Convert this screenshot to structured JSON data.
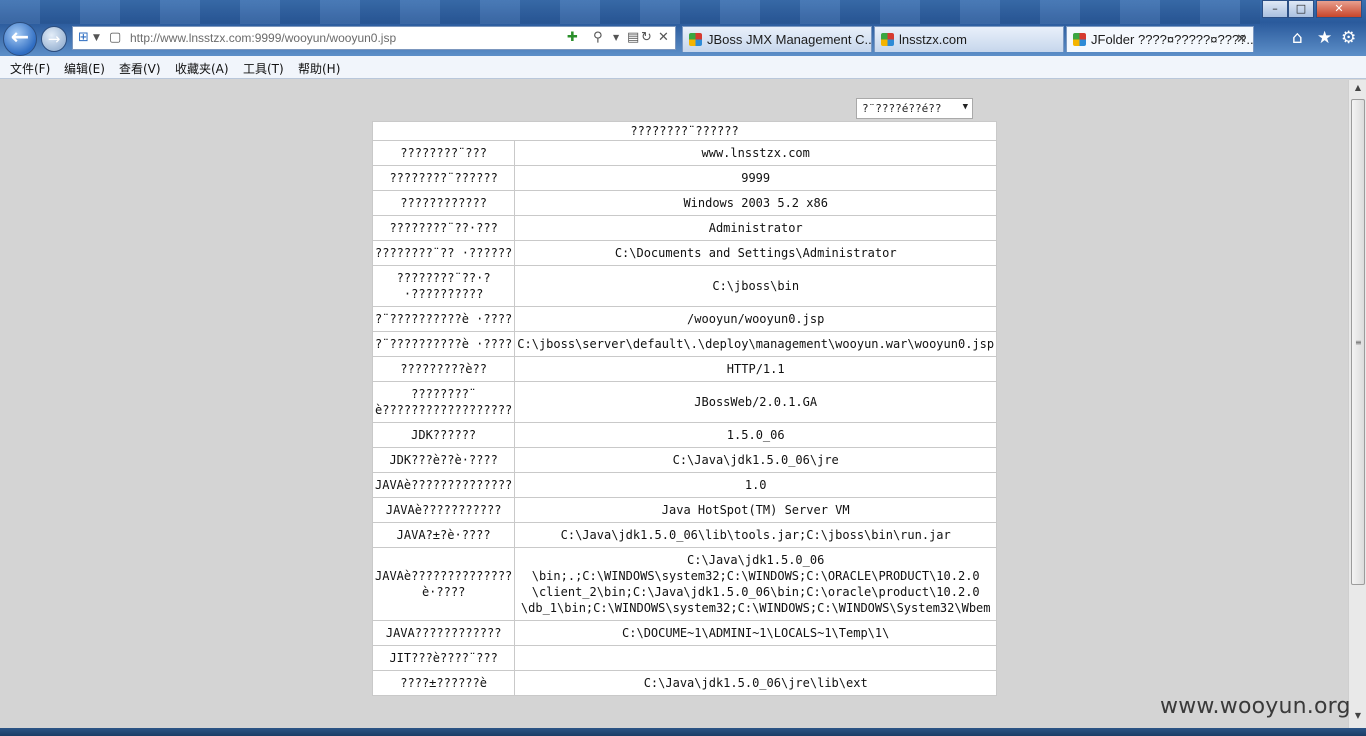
{
  "browser": {
    "url": "http://www.lnsstzx.com:9999/wooyun/wooyun0.jsp",
    "tabs": [
      {
        "label": "JBoss JMX Management C..."
      },
      {
        "label": "lnsstzx.com"
      },
      {
        "label": "JFolder ????¤?????¤????..."
      }
    ],
    "window_controls": {
      "minimize": "–",
      "maximize": "□",
      "close": "✕"
    }
  },
  "menubar": [
    "文件(F)",
    "编辑(E)",
    "查看(V)",
    "收藏夹(A)",
    "工具(T)",
    "帮助(H)"
  ],
  "page": {
    "language_select": "?¨????é??é??",
    "table_title": "????????¨??????",
    "rows": [
      {
        "label": "????????¨???",
        "value": "www.lnsstzx.com"
      },
      {
        "label": "????????¨??????",
        "value": "9999"
      },
      {
        "label": "????????????",
        "value": "Windows 2003 5.2 x86"
      },
      {
        "label": "????????¨??·???",
        "value": "Administrator"
      },
      {
        "label": "????????¨?? ·??????",
        "value": "C:\\Documents and Settings\\Administrator"
      },
      {
        "label": "????????¨??·? ·??????????",
        "value": "C:\\jboss\\bin"
      },
      {
        "label": "?¨??????????è ·????",
        "value": "/wooyun/wooyun0.jsp"
      },
      {
        "label": "?¨??????????è ·????",
        "value": "C:\\jboss\\server\\default\\.\\deploy\\management\\wooyun.war\\wooyun0.jsp"
      },
      {
        "label": "?????????è??",
        "value": "HTTP/1.1"
      },
      {
        "label": "????????¨ è??????????????????",
        "value": "JBossWeb/2.0.1.GA"
      },
      {
        "label": "JDK??????",
        "value": "1.5.0_06"
      },
      {
        "label": "JDK???è??è·????",
        "value": "C:\\Java\\jdk1.5.0_06\\jre"
      },
      {
        "label": "JAVAè??????????????",
        "value": "1.0"
      },
      {
        "label": "JAVAè???????????",
        "value": "Java HotSpot(TM) Server VM"
      },
      {
        "label": "JAVA?±?è·????",
        "value": "C:\\Java\\jdk1.5.0_06\\lib\\tools.jar;C:\\jboss\\bin\\run.jar"
      },
      {
        "label": "JAVAè?????????????? è·????",
        "value": "C:\\Java\\jdk1.5.0_06 \\bin;.;C:\\WINDOWS\\system32;C:\\WINDOWS;C:\\ORACLE\\PRODUCT\\10.2.0 \\client_2\\bin;C:\\Java\\jdk1.5.0_06\\bin;C:\\oracle\\product\\10.2.0 \\db_1\\bin;C:\\WINDOWS\\system32;C:\\WINDOWS;C:\\WINDOWS\\System32\\Wbem"
      },
      {
        "label": "JAVA????????????",
        "value": "C:\\DOCUME~1\\ADMINI~1\\LOCALS~1\\Temp\\1\\"
      },
      {
        "label": "JIT???è????¨???",
        "value": ""
      },
      {
        "label": "????±??????è",
        "value": "C:\\Java\\jdk1.5.0_06\\jre\\lib\\ext"
      }
    ]
  },
  "watermark": "www.wooyun.org"
}
